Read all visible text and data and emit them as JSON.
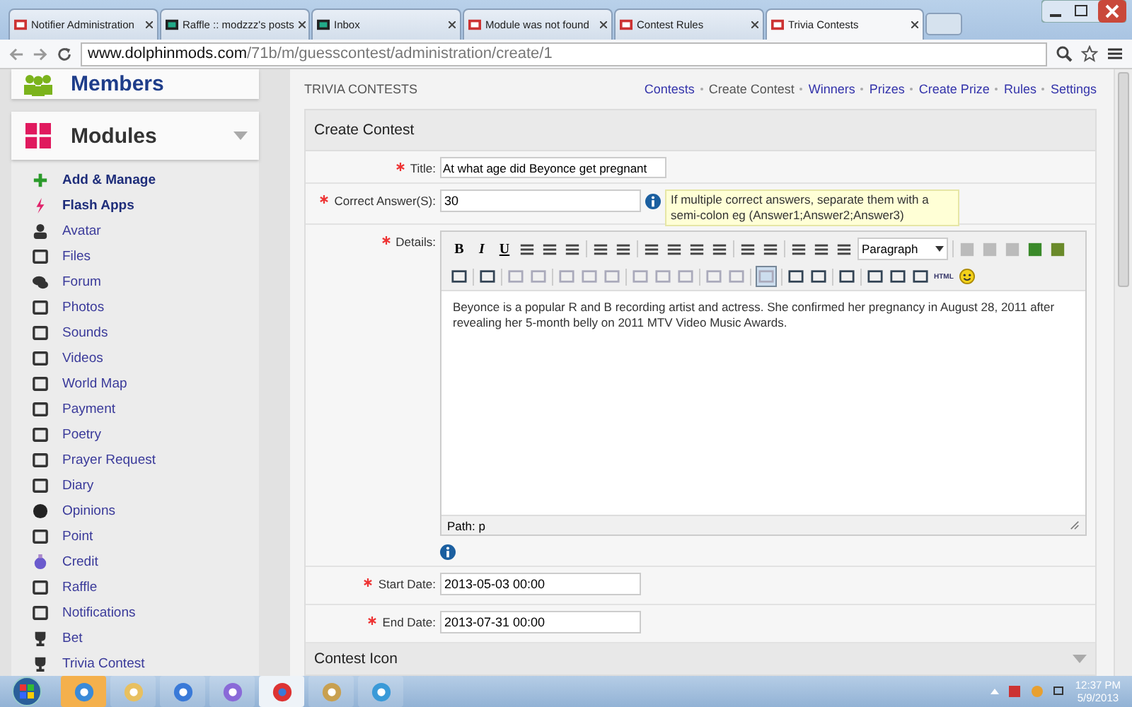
{
  "browser_tabs": [
    {
      "title": "Notifier Administration",
      "selected": false
    },
    {
      "title": "Raffle :: modzzz's posts",
      "selected": false
    },
    {
      "title": "Inbox",
      "selected": false
    },
    {
      "title": "Module was not found",
      "selected": false
    },
    {
      "title": "Contest Rules",
      "selected": false
    },
    {
      "title": "Trivia Contests",
      "selected": true
    }
  ],
  "address_bar": {
    "domain": "www.dolphinmods.com",
    "path": "/71b/m/guesscontest/administration/create/1"
  },
  "sidebar": {
    "members_title": "Members",
    "modules_title": "Modules",
    "modules_expanded": true,
    "items": [
      {
        "label": "Add & Manage",
        "kind": "action"
      },
      {
        "label": "Flash Apps",
        "kind": "action"
      },
      {
        "label": "Avatar",
        "kind": "module"
      },
      {
        "label": "Files",
        "kind": "module"
      },
      {
        "label": "Forum",
        "kind": "module"
      },
      {
        "label": "Photos",
        "kind": "module"
      },
      {
        "label": "Sounds",
        "kind": "module"
      },
      {
        "label": "Videos",
        "kind": "module"
      },
      {
        "label": "World Map",
        "kind": "module"
      },
      {
        "label": "Payment",
        "kind": "module"
      },
      {
        "label": "Poetry",
        "kind": "module"
      },
      {
        "label": "Prayer Request",
        "kind": "module"
      },
      {
        "label": "Diary",
        "kind": "module"
      },
      {
        "label": "Opinions",
        "kind": "module"
      },
      {
        "label": "Point",
        "kind": "module"
      },
      {
        "label": "Credit",
        "kind": "module"
      },
      {
        "label": "Raffle",
        "kind": "module"
      },
      {
        "label": "Notifications",
        "kind": "module"
      },
      {
        "label": "Bet",
        "kind": "module"
      },
      {
        "label": "Trivia Contest",
        "kind": "module"
      }
    ]
  },
  "page_title": "TRIVIA CONTESTS",
  "nav_links": [
    {
      "label": "Contests",
      "selected": false
    },
    {
      "label": "Create Contest",
      "selected": true
    },
    {
      "label": "Winners",
      "selected": false
    },
    {
      "label": "Prizes",
      "selected": false
    },
    {
      "label": "Create Prize",
      "selected": false
    },
    {
      "label": "Rules",
      "selected": false
    },
    {
      "label": "Settings",
      "selected": false
    }
  ],
  "form": {
    "title": "Create Contest",
    "title_field": {
      "label": "Title:",
      "value": "At what age did Beyonce get pregnant"
    },
    "answer_field": {
      "label": "Correct Answer(S):",
      "value": "30",
      "hint": "If multiple correct answers, separate them with a semi-colon eg (Answer1;Answer2;Answer3)"
    },
    "details": {
      "label": "Details:",
      "format_buttons": [
        "B",
        "I",
        "U"
      ],
      "block_format": "Paragraph",
      "html_button": "HTML",
      "content": "Beyonce is a popular R and B recording artist and actress. She confirmed her pregnancy in August 28, 2011 after revealing her 5-month belly on 2011 MTV Video Music Awards.",
      "path": "Path: p"
    },
    "start_date": {
      "label": "Start Date:",
      "value": "2013-05-03 00:00"
    },
    "end_date": {
      "label": "End Date:",
      "value": "2013-07-31 00:00"
    },
    "next_section": "Contest Icon"
  },
  "taskbar": {
    "time": "12:37 PM",
    "date": "5/9/2013"
  }
}
